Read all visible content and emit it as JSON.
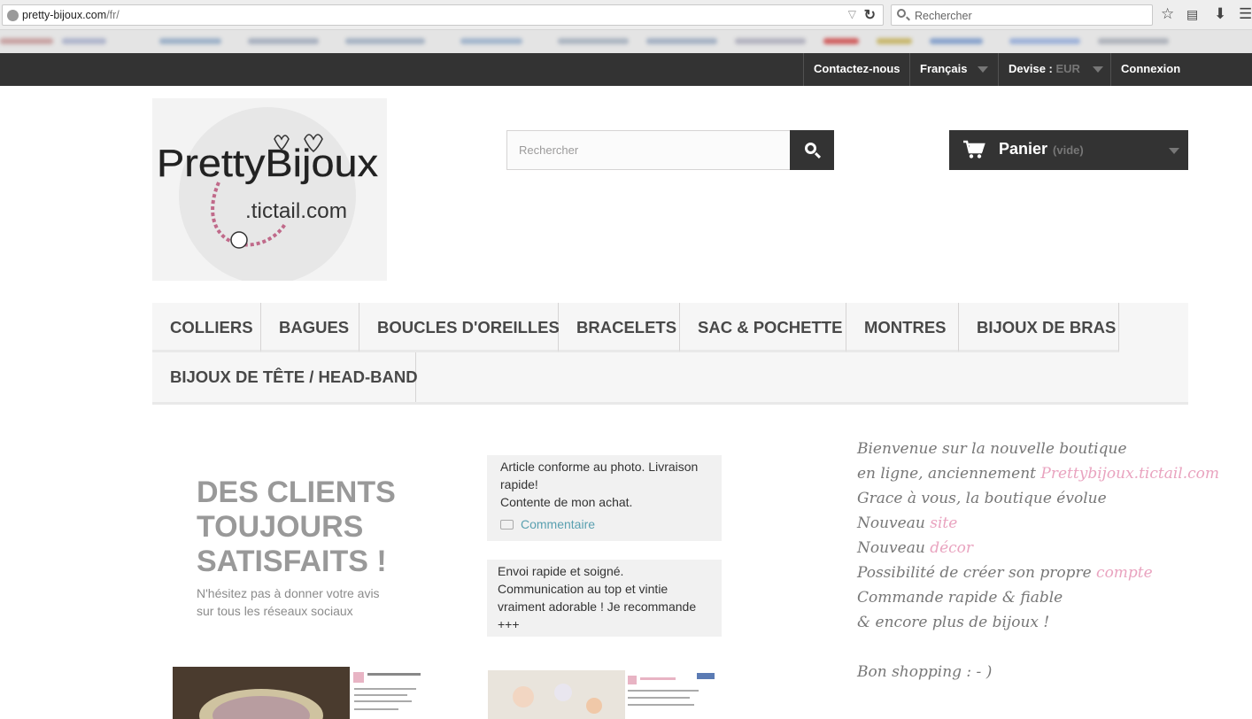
{
  "browser": {
    "url_host": "pretty-bijoux.com",
    "url_path": "/fr/",
    "search_placeholder": "Rechercher"
  },
  "topnav": {
    "contact": "Contactez-nous",
    "language": "Français",
    "currency_label": "Devise :",
    "currency_value": "EUR",
    "login": "Connexion"
  },
  "header": {
    "search_placeholder": "Rechercher",
    "cart_label": "Panier",
    "cart_status": "(vide)"
  },
  "logo": {
    "line1": "PrettyBijoux",
    "line2": ".tictail.com"
  },
  "menu": {
    "items": [
      "COLLIERS",
      "BAGUES",
      "BOUCLES D'OREILLES",
      "BRACELETS",
      "SAC & POCHETTE",
      "MONTRES",
      "BIJOUX DE BRAS",
      "BIJOUX DE TÊTE / HEAD-BAND"
    ]
  },
  "promo": {
    "title": "DES CLIENTS TOUJOURS SATISFAITS !",
    "text": "N'hésitez pas à donner votre avis sur tous les réseaux sociaux"
  },
  "reviews": [
    {
      "line1": "Article conforme au photo. Livraison rapide!",
      "line2": "Contente de mon achat.",
      "comment": "Commentaire"
    },
    {
      "text": "Envoi rapide et soigné. Communication au top et vintie vraiment adorable ! Je recommande +++"
    }
  ],
  "welcome": {
    "line1": "Bienvenue sur la nouvelle boutique",
    "line2_prefix": "en ligne, anciennement",
    "line2_link": "Prettybijoux.tictail.com",
    "line3": "Grace à vous, la boutique évolue",
    "line4_prefix": "Nouveau",
    "line4_word": "site",
    "line5_prefix": "Nouveau",
    "line5_word": "décor",
    "line6_prefix": "Possibilité de créer son propre",
    "line6_word": "compte",
    "line7": "Commande rapide & fiable",
    "line8": "& encore plus de bijoux !",
    "line9": "Bon shopping : - )"
  },
  "colors": {
    "dark": "#333333",
    "menu_text": "#484848",
    "pink_accent": "#e9a3bf",
    "link_teal": "#5aa0b0"
  }
}
